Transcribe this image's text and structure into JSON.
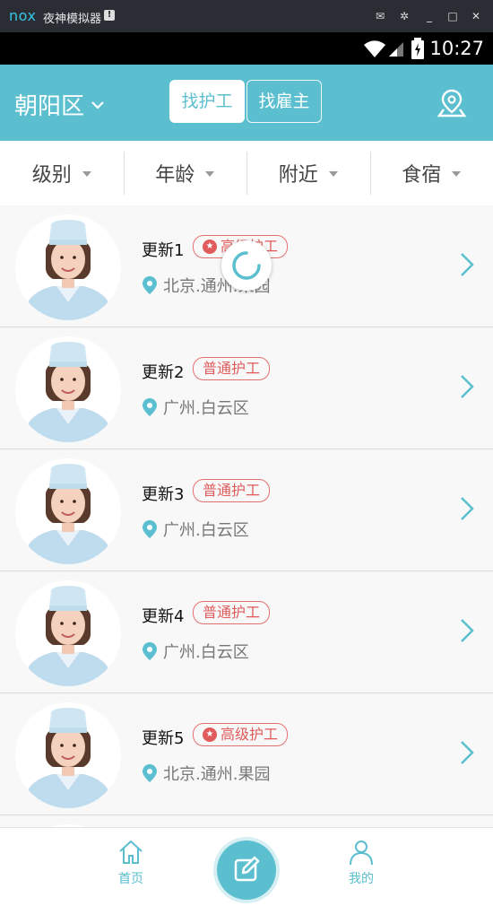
{
  "emulator": {
    "logo": "nox",
    "title": "夜神模拟器",
    "badge": "!"
  },
  "status": {
    "time": "10:27"
  },
  "header": {
    "region": "朝阳区",
    "tabs": [
      "找护工",
      "找雇主"
    ]
  },
  "filters": [
    "级别",
    "年龄",
    "附近",
    "食宿"
  ],
  "list": [
    {
      "name": "更新1",
      "badge": "高级护工",
      "starred": true,
      "location": "北京.通州.果园"
    },
    {
      "name": "更新2",
      "badge": "普通护工",
      "starred": false,
      "location": "广州.白云区"
    },
    {
      "name": "更新3",
      "badge": "普通护工",
      "starred": false,
      "location": "广州.白云区"
    },
    {
      "name": "更新4",
      "badge": "普通护工",
      "starred": false,
      "location": "广州.白云区"
    },
    {
      "name": "更新5",
      "badge": "高级护工",
      "starred": true,
      "location": "北京.通州.果园"
    }
  ],
  "tabbar": {
    "home": "首页",
    "me": "我的"
  },
  "colors": {
    "accent": "#5bbfcf",
    "badge": "#e05b5b"
  }
}
